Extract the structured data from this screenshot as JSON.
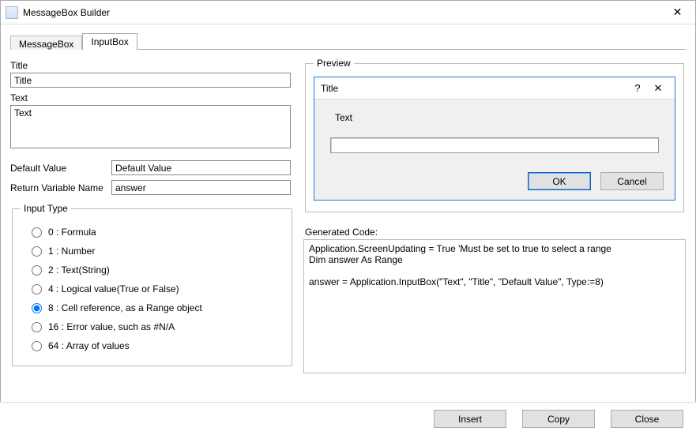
{
  "window": {
    "title": "MessageBox Builder"
  },
  "tabs": {
    "messagebox": "MessageBox",
    "inputbox": "InputBox"
  },
  "labels": {
    "title": "Title",
    "text": "Text",
    "default_value": "Default Value",
    "return_var": "Return Variable Name",
    "input_type": "Input Type",
    "preview": "Preview",
    "generated_code": "Generated Code:"
  },
  "fields": {
    "title": "Title",
    "text": "Text",
    "default_value": "Default Value",
    "return_var": "answer"
  },
  "input_types": [
    {
      "label": "0 : Formula",
      "checked": false
    },
    {
      "label": "1 : Number",
      "checked": false
    },
    {
      "label": "2 : Text(String)",
      "checked": false
    },
    {
      "label": "4 : Logical value(True or False)",
      "checked": false
    },
    {
      "label": "8 : Cell reference, as a Range object",
      "checked": true
    },
    {
      "label": "16 : Error value, such as #N/A",
      "checked": false
    },
    {
      "label": "64 : Array of values",
      "checked": false
    }
  ],
  "preview": {
    "title": "Title",
    "text": "Text",
    "ok": "OK",
    "cancel": "Cancel"
  },
  "generated_code": "Application.ScreenUpdating = True 'Must be set to true to select a range\nDim answer As Range\n\nanswer = Application.InputBox(\"Text\", \"Title\", \"Default Value\", Type:=8)",
  "buttons": {
    "insert": "Insert",
    "copy": "Copy",
    "close": "Close"
  }
}
